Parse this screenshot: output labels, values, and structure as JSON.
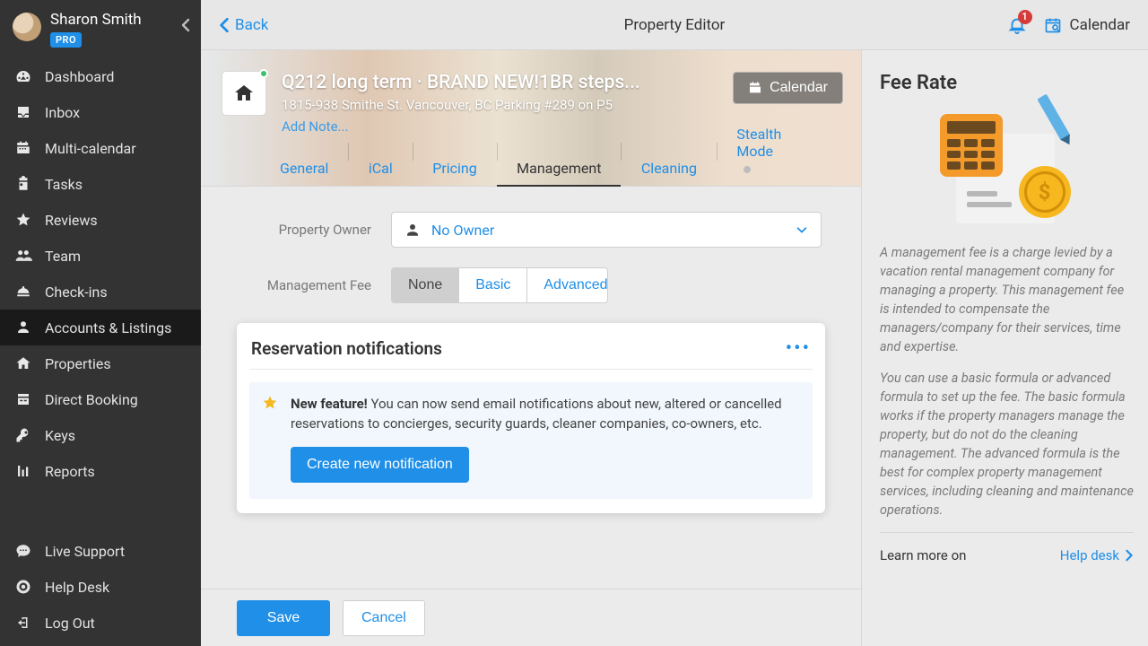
{
  "user": {
    "name": "Sharon Smith",
    "badge": "PRO"
  },
  "sidebar": {
    "items": [
      {
        "label": "Dashboard"
      },
      {
        "label": "Inbox"
      },
      {
        "label": "Multi-calendar"
      },
      {
        "label": "Tasks"
      },
      {
        "label": "Reviews"
      },
      {
        "label": "Team"
      },
      {
        "label": "Check-ins"
      },
      {
        "label": "Accounts & Listings"
      },
      {
        "label": "Properties"
      },
      {
        "label": "Direct Booking"
      },
      {
        "label": "Keys"
      },
      {
        "label": "Reports"
      }
    ],
    "active_index": 7,
    "footer": [
      {
        "label": "Live Support"
      },
      {
        "label": "Help Desk"
      },
      {
        "label": "Log Out"
      }
    ]
  },
  "topbar": {
    "back": "Back",
    "title": "Property Editor",
    "notification_count": "1",
    "calendar": "Calendar"
  },
  "hero": {
    "title": "Q212 long term · BRAND NEW!1BR steps...",
    "address": "1815-938 Smithe St. Vancouver, BC Parking #289 on P5",
    "add_note": "Add Note...",
    "calendar_btn": "Calendar"
  },
  "tabs": {
    "items": [
      "General",
      "iCal",
      "Pricing",
      "Management",
      "Cleaning",
      "Stealth Mode"
    ],
    "active_index": 3
  },
  "form": {
    "owner_label": "Property Owner",
    "owner_value": "No Owner",
    "fee_label": "Management Fee",
    "fee_options": [
      "None",
      "Basic",
      "Advanced"
    ],
    "fee_selected_index": 0
  },
  "card": {
    "title": "Reservation notifications",
    "feature_bold": "New feature!",
    "feature_text": " You can now send email notifications about new, altered or cancelled reservations to concierges, security guards, cleaner companies, co-owners, etc.",
    "button": "Create new notification"
  },
  "footer": {
    "save": "Save",
    "cancel": "Cancel"
  },
  "right": {
    "title": "Fee Rate",
    "p1": "A management fee is a charge levied by a vacation rental management company for managing a property. This management fee is intended to compensate the managers/company for their services, time and expertise.",
    "p2": "You can use a basic formula or advanced formula to set up the fee. The basic formula works if the property managers manage the property, but do not do the cleaning management. The advanced formula is the best for complex property management services, including cleaning and maintenance operations.",
    "learn": "Learn more on",
    "help": "Help desk"
  }
}
